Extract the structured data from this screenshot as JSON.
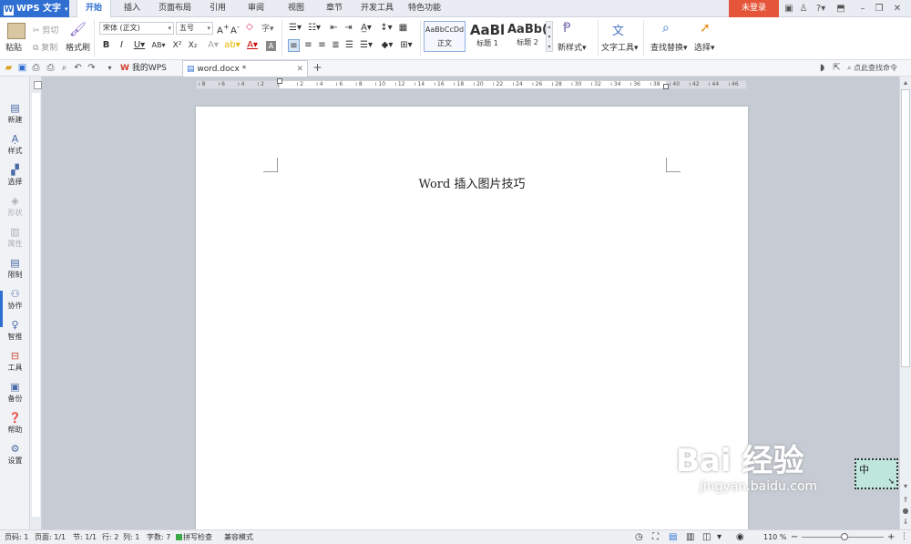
{
  "app": {
    "name": "WPS 文字",
    "login_label": "未登录"
  },
  "menu_tabs": [
    "开始",
    "插入",
    "页面布局",
    "引用",
    "审阅",
    "视图",
    "章节",
    "开发工具",
    "特色功能"
  ],
  "active_tab": "开始",
  "ribbon": {
    "paste": "粘贴",
    "cut": "剪切",
    "copy": "复制",
    "format_painter": "格式刷",
    "font_name": "宋体 (正文)",
    "font_size": "五号",
    "styles": [
      {
        "preview": "AaBbCcDd",
        "name": "正文"
      },
      {
        "preview": "AaBl",
        "name": "标题 1"
      },
      {
        "preview": "AaBb(",
        "name": "标题 2"
      }
    ],
    "new_style": "新样式",
    "text_tools": "文字工具",
    "find_replace": "查找替换",
    "select": "选择"
  },
  "doc_tabs": [
    {
      "label": "我的WPS"
    },
    {
      "label": "word.docx *"
    }
  ],
  "search_commands": "点此查找命令",
  "left_nav": [
    {
      "label": "新建",
      "icon": "new-doc-icon"
    },
    {
      "label": "样式",
      "icon": "style-icon"
    },
    {
      "label": "选择",
      "icon": "select-icon"
    },
    {
      "label": "形状",
      "icon": "shape-icon"
    },
    {
      "label": "属性",
      "icon": "property-icon"
    },
    {
      "label": "限制",
      "icon": "restrict-icon"
    },
    {
      "label": "协作",
      "icon": "collaborate-icon"
    },
    {
      "label": "智推",
      "icon": "smart-push-icon"
    },
    {
      "label": "工具",
      "icon": "toolbox-icon"
    },
    {
      "label": "备份",
      "icon": "backup-icon"
    },
    {
      "label": "帮助",
      "icon": "help-icon"
    },
    {
      "label": "设置",
      "icon": "settings-icon"
    }
  ],
  "ruler_numbers": [
    "8",
    "6",
    "4",
    "2",
    "",
    "2",
    "4",
    "6",
    "8",
    "10",
    "12",
    "14",
    "16",
    "18",
    "20",
    "22",
    "24",
    "26",
    "28",
    "30",
    "32",
    "34",
    "36",
    "38",
    "40",
    "42",
    "44",
    "46"
  ],
  "document": {
    "title": "Word 插入图片技巧"
  },
  "status": {
    "page_code": "页码: 1",
    "pages": "页面: 1/1",
    "section": "节: 1/1",
    "row": "行: 2",
    "col": "列: 1",
    "word_count": "字数: 7",
    "spell_check": "拼写检查",
    "compat_mode": "兼容模式",
    "zoom": "110 %"
  },
  "watermark": {
    "text": "Bai 经验",
    "url": "jingyan.baidu.com"
  },
  "ime": {
    "label": "中"
  },
  "colors": {
    "accent": "#2f6fd2",
    "login": "#e4553a",
    "page": "#ffffff",
    "workspace": "#c6cbd4"
  }
}
